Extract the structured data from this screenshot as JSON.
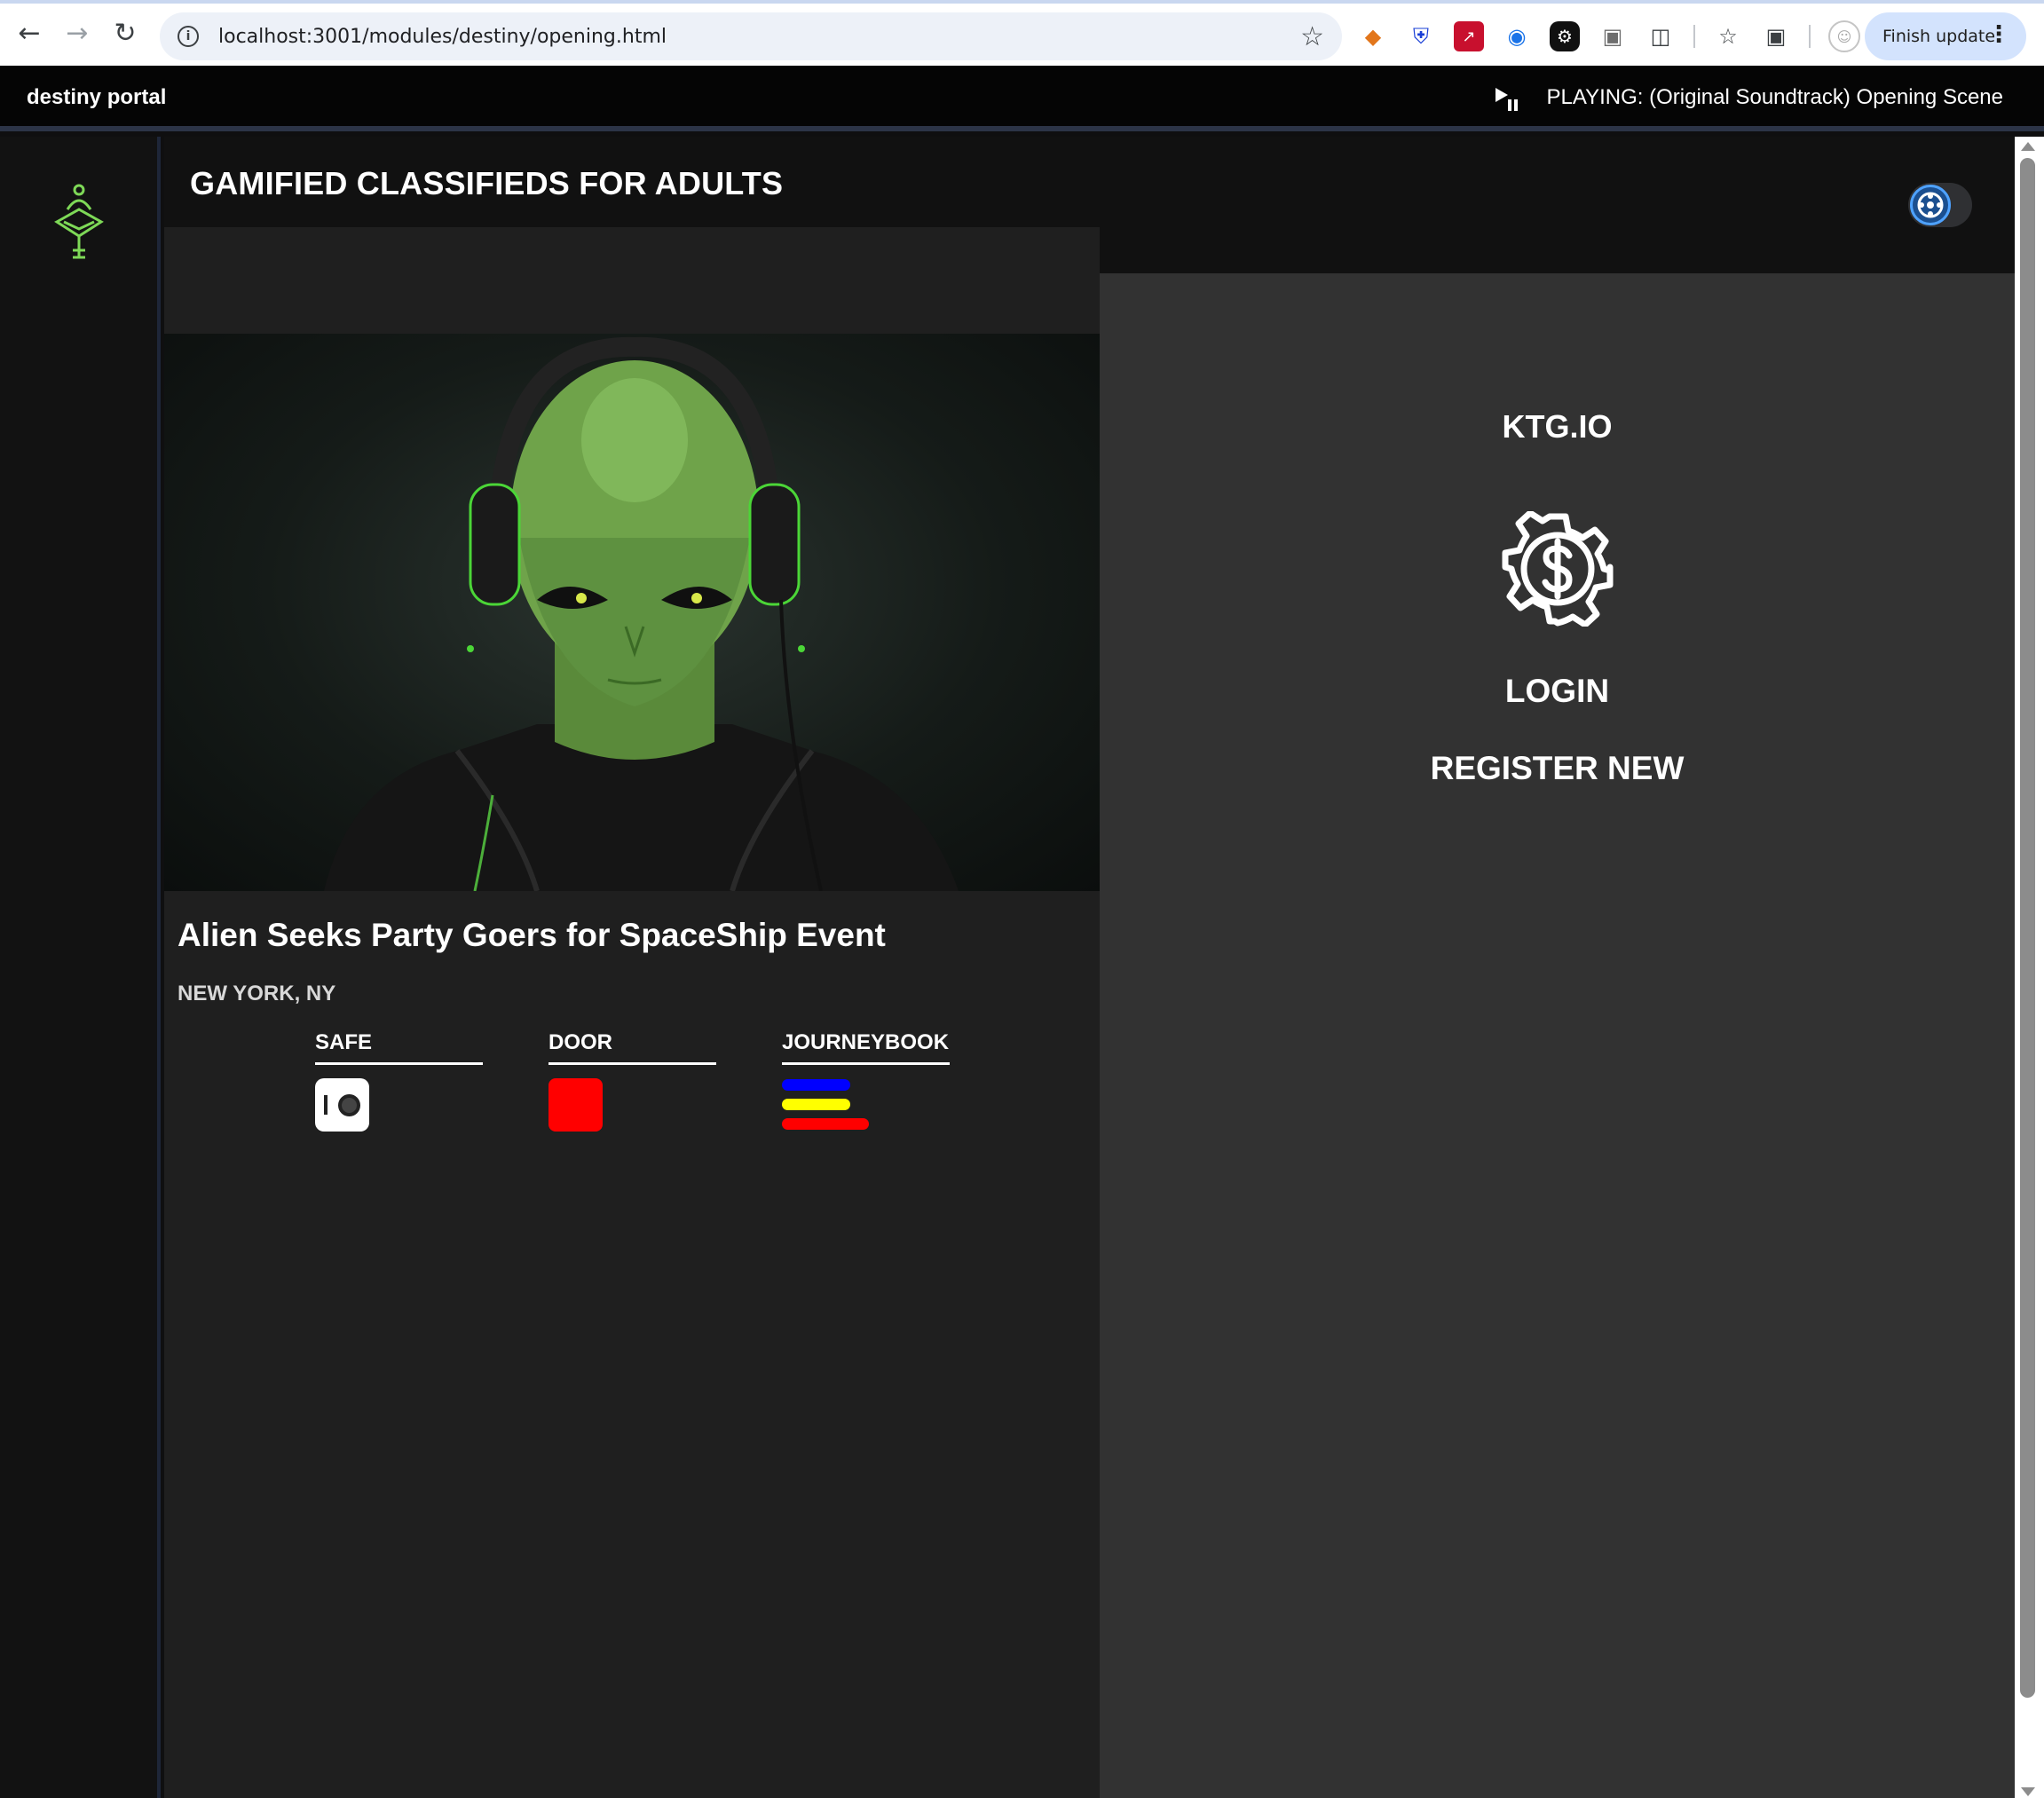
{
  "browser": {
    "url": "localhost:3001/modules/destiny/opening.html",
    "finish_update_label": "Finish update",
    "extensions": [
      "metamask-fox-icon",
      "shield-icon",
      "pdf-icon",
      "circle-icon",
      "cog-icon",
      "rainbow-icon",
      "puzzle-icon"
    ]
  },
  "app": {
    "portal_title": "destiny portal",
    "now_playing": "PLAYING: (Original Soundtrack) Opening Scene"
  },
  "header": {
    "title": "GAMIFIED CLASSIFIEDS FOR ADULTS"
  },
  "listing": {
    "title": "Alien Seeks Party Goers for SpaceShip Event",
    "location": "NEW YORK, NY",
    "actions": [
      {
        "label": "SAFE"
      },
      {
        "label": "DOOR"
      },
      {
        "label": "JOURNEYBOOK"
      }
    ]
  },
  "auth_panel": {
    "brand": "KTG.IO",
    "login_label": "LOGIN",
    "register_label": "REGISTER NEW"
  },
  "colors": {
    "accent_green": "#7ed957",
    "door_red": "#ff0000",
    "journey_blue": "#0000ff",
    "journey_yellow": "#ffff00",
    "journey_red": "#ff0000"
  }
}
